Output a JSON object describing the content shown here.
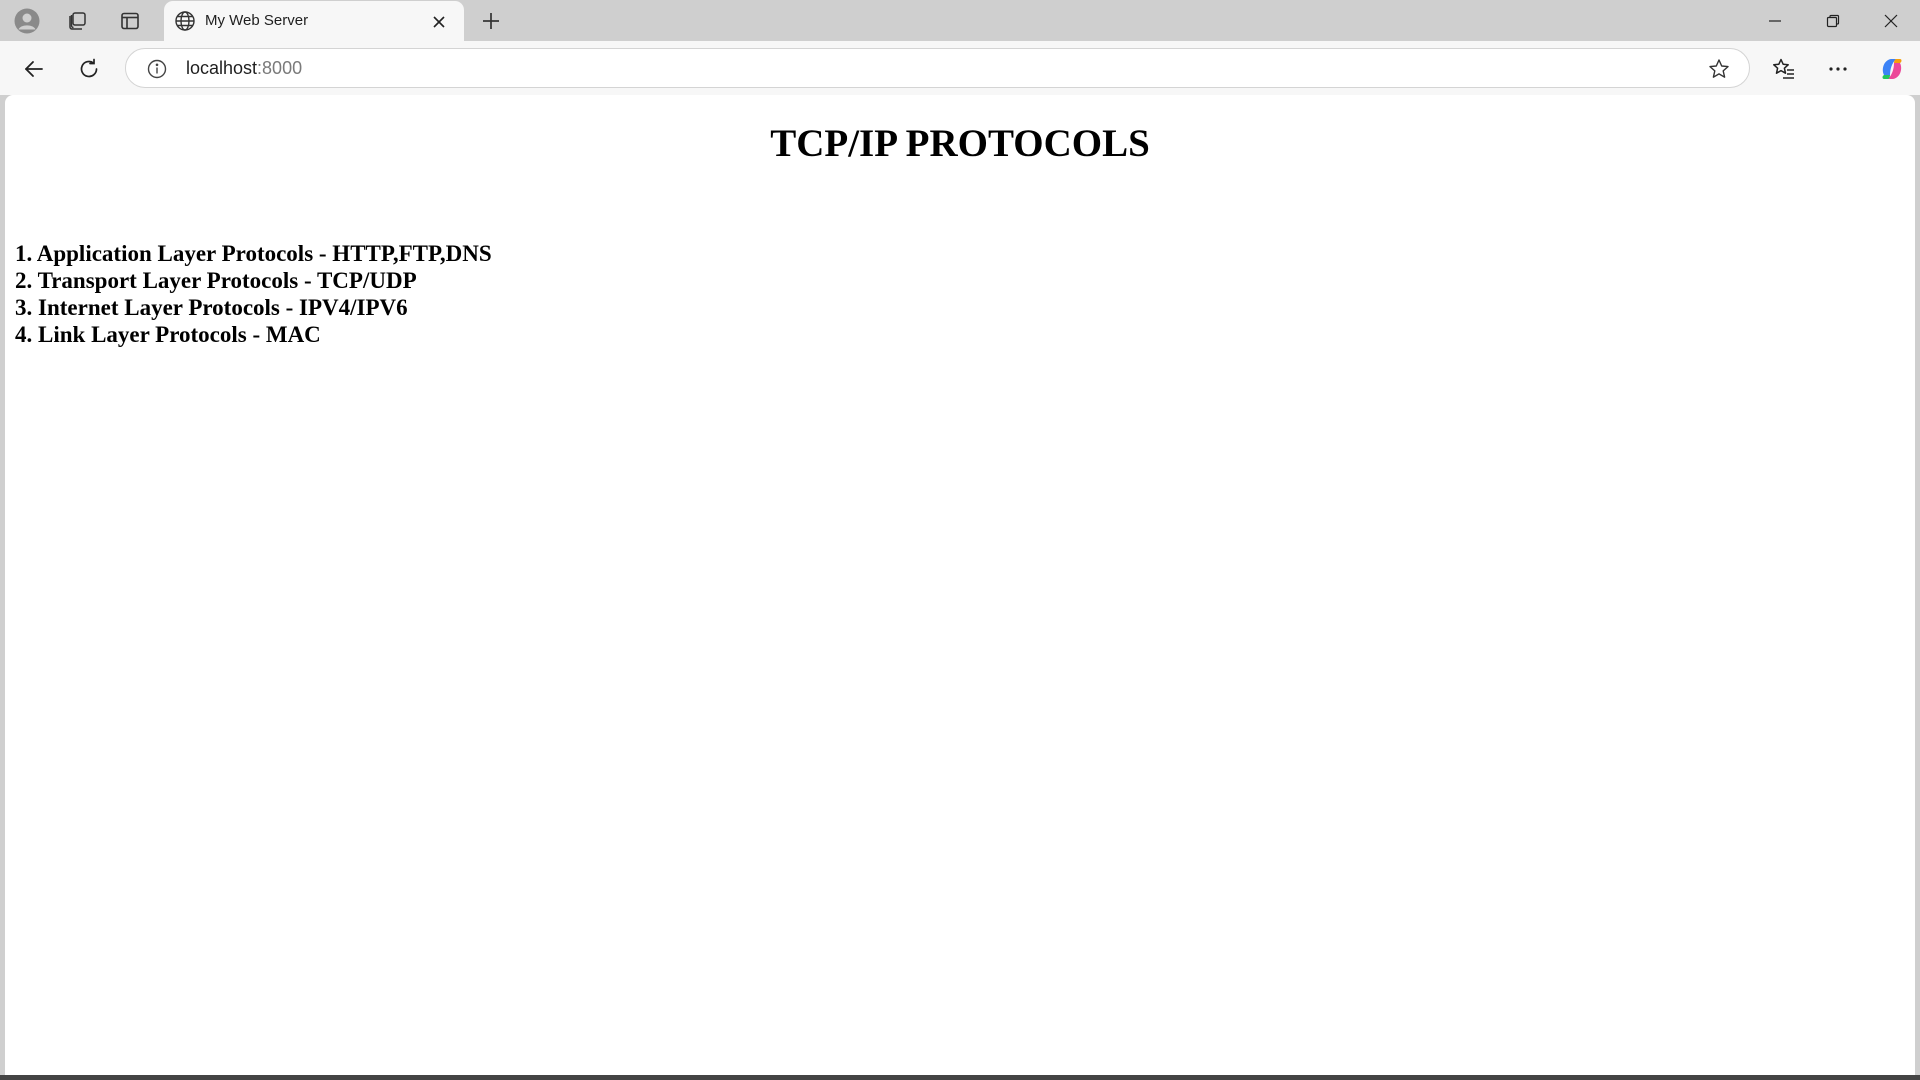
{
  "browser": {
    "tab": {
      "title": "My Web Server",
      "icon": "globe-icon"
    },
    "address_bar": {
      "host": "localhost",
      "port": ":8000"
    },
    "toolbar_icons": [
      "back-arrow-icon",
      "reload-icon",
      "info-icon",
      "star-icon",
      "favorites-icon",
      "more-icon",
      "copilot-icon"
    ],
    "window_controls": [
      "minimize-icon",
      "restore-icon",
      "close-icon"
    ],
    "copilot_colors": [
      "#3b82f6",
      "#ec4899",
      "#f59e0b",
      "#22c55e"
    ]
  },
  "page": {
    "heading": "TCP/IP PROTOCOLS",
    "items": [
      "1. Application Layer Protocols - HTTP,FTP,DNS",
      "2. Transport Layer Protocols - TCP/UDP",
      "3. Internet Layer Protocols - IPV4/IPV6",
      "4. Link Layer Protocols - MAC"
    ]
  }
}
